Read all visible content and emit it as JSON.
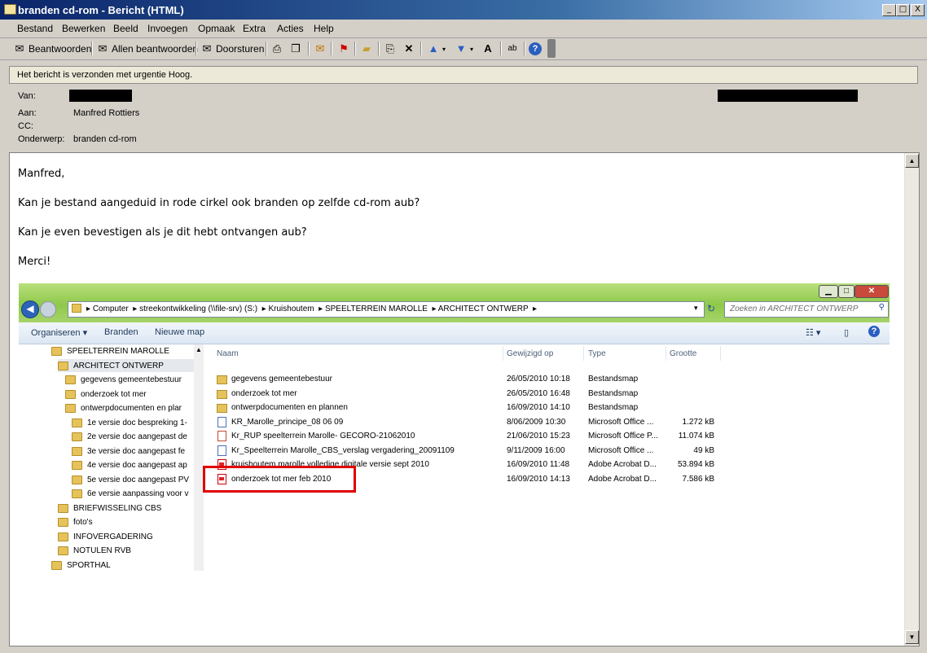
{
  "window": {
    "title": "branden cd-rom - Bericht (HTML)",
    "controls": [
      "_",
      "□",
      "X"
    ]
  },
  "menu": [
    "Bestand",
    "Bewerken",
    "Beeld",
    "Invoegen",
    "Opmaak",
    "Extra",
    "Acties",
    "Help"
  ],
  "toolbar": {
    "reply": "Beantwoorden",
    "reply_all": "Allen beantwoorden",
    "forward": "Doorsturen",
    "icons": [
      "print-icon",
      "copy-icon",
      "envelope-icon",
      "flag-icon",
      "open-folder-icon",
      "move-icon",
      "delete-icon",
      "up-arrow-icon",
      "down-arrow-icon",
      "font-size-icon",
      "spell-icon",
      "help-icon"
    ]
  },
  "info_bar": "Het bericht is verzonden met urgentie Hoog.",
  "header": {
    "from_label": "Van:",
    "to_label": "Aan:",
    "to_value": "Manfred Rottiers",
    "cc_label": "CC:",
    "subject_label": "Onderwerp:",
    "subject_value": "branden cd-rom"
  },
  "message": {
    "greeting": "Manfred,",
    "line1": "Kan je bestand aangeduid in rode cirkel ook branden op zelfde cd-rom aub?",
    "line2": "Kan je even bevestigen als je dit hebt ontvangen aub?",
    "closing": "Merci!"
  },
  "explorer": {
    "breadcrumb": [
      "Computer",
      "streekontwikkeling (\\\\file-srv) (S:)",
      "Kruishoutem",
      "SPEELTERREIN MAROLLE",
      "ARCHITECT ONTWERP"
    ],
    "search_placeholder": "Zoeken in ARCHITECT ONTWERP",
    "commands": [
      "Organiseren ▾",
      "Branden",
      "Nieuwe map"
    ],
    "nav_tree": [
      "SPEELTERREIN MAROLLE",
      "ARCHITECT ONTWERP",
      "gegevens gemeentebestuur",
      "onderzoek tot mer",
      "ontwerpdocumenten en plar",
      "1e versie doc bespreking 1-",
      "2e versie doc aangepast de",
      "3e versie doc aangepast fe",
      "4e versie doc aangepast ap",
      "5e versie doc aangepast PV",
      "6e versie aanpassing voor v",
      "BRIEFWISSELING CBS",
      "foto's",
      "INFOVERGADERING",
      "NOTULEN RVB",
      "SPORTHAL"
    ],
    "columns": [
      "Naam",
      "Gewijzigd op",
      "Type",
      "Grootte"
    ],
    "files": [
      {
        "name": "gegevens gemeentebestuur",
        "date": "26/05/2010 10:18",
        "type": "Bestandsmap",
        "size": "",
        "kind": "folder"
      },
      {
        "name": "onderzoek tot mer",
        "date": "26/05/2010 16:48",
        "type": "Bestandsmap",
        "size": "",
        "kind": "folder"
      },
      {
        "name": "ontwerpdocumenten en plannen",
        "date": "16/09/2010 14:10",
        "type": "Bestandsmap",
        "size": "",
        "kind": "folder"
      },
      {
        "name": "KR_Marolle_principe_08 06 09",
        "date": "8/06/2009 10:30",
        "type": "Microsoft Office ...",
        "size": "1.272 kB",
        "kind": "doc"
      },
      {
        "name": "Kr_RUP speelterrein Marolle- GECORO-21062010",
        "date": "21/06/2010 15:23",
        "type": "Microsoft Office P...",
        "size": "11.074 kB",
        "kind": "ppt"
      },
      {
        "name": "Kr_Speelterrein Marolle_CBS_verslag vergadering_20091109",
        "date": "9/11/2009 16:00",
        "type": "Microsoft Office ...",
        "size": "49 kB",
        "kind": "doc"
      },
      {
        "name": "kruishoutem marolle volledige digitale versie sept 2010",
        "date": "16/09/2010 11:48",
        "type": "Adobe Acrobat D...",
        "size": "53.894 kB",
        "kind": "pdf"
      },
      {
        "name": "onderzoek tot mer feb 2010",
        "date": "16/09/2010 14:13",
        "type": "Adobe Acrobat D...",
        "size": "7.586 kB",
        "kind": "pdf"
      }
    ],
    "highlight_color": "#e00000"
  }
}
